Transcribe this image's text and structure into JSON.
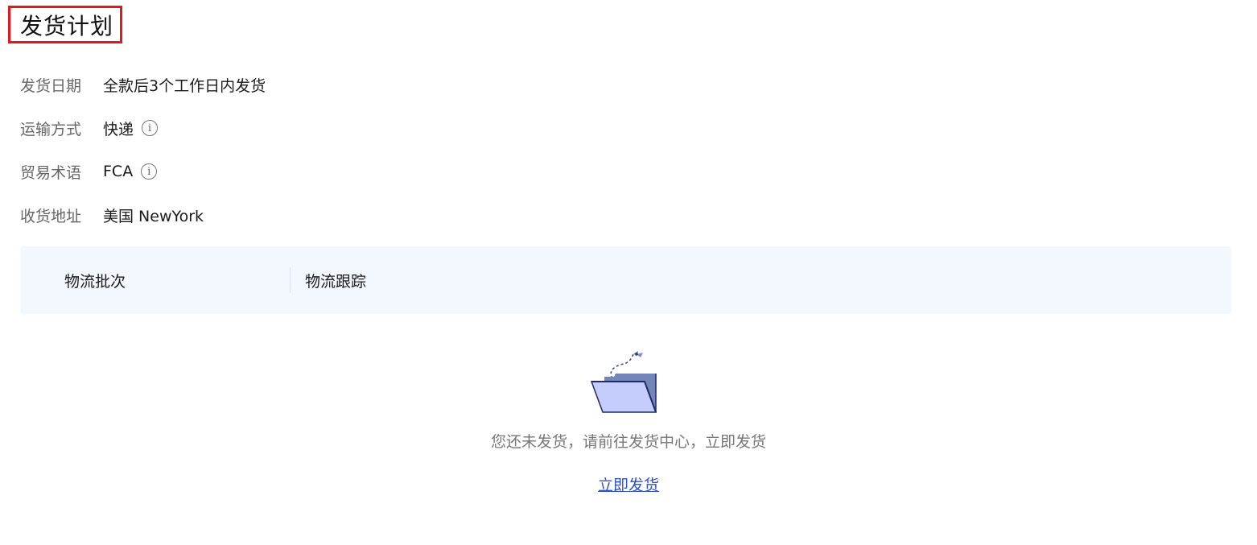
{
  "page": {
    "title": "发货计划"
  },
  "info": {
    "ship_date": {
      "label": "发货日期",
      "value": "全款后3个工作日内发货"
    },
    "transport": {
      "label": "运输方式",
      "value": "快递",
      "icon": "info-circle-icon"
    },
    "trade_terms": {
      "label": "贸易术语",
      "value": "FCA",
      "icon": "info-circle-icon"
    },
    "address": {
      "label": "收货地址",
      "value": "美国 NewYork"
    }
  },
  "tabs": [
    {
      "label": "物流批次"
    },
    {
      "label": "物流跟踪"
    }
  ],
  "empty_state": {
    "icon": "empty-folder-icon",
    "message": "您还未发货，请前往发货中心，立即发货",
    "action_label": "立即发货"
  },
  "colors": {
    "title_highlight_border": "#e0191e",
    "tabs_background": "#f3f7fe",
    "link": "#2f4fd0"
  }
}
